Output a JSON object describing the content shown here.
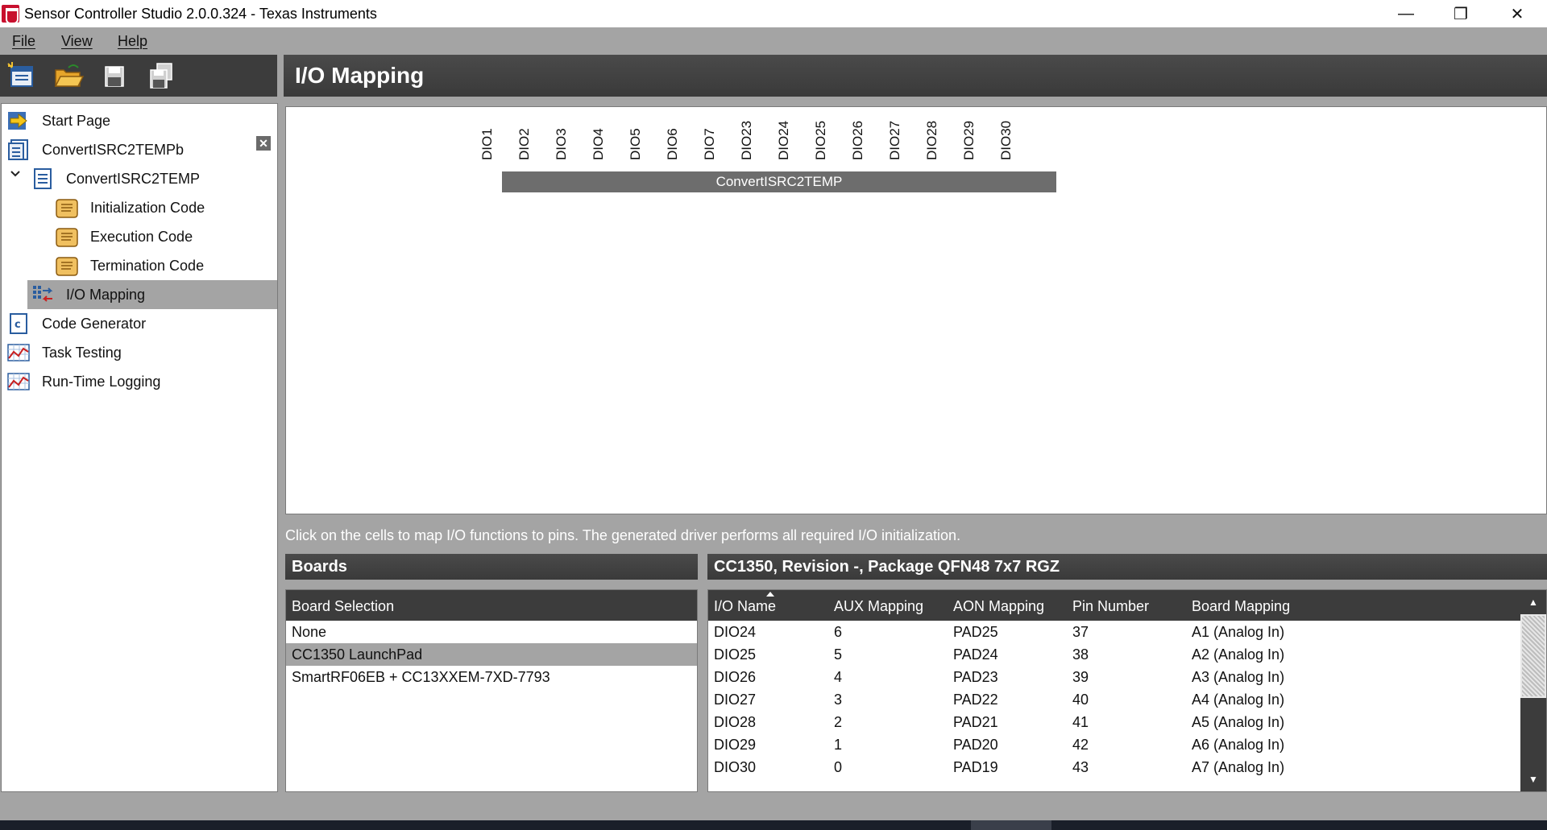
{
  "window": {
    "title": "Sensor Controller Studio 2.0.0.324 - Texas Instruments",
    "minimize": "—",
    "restore": "❐",
    "close": "✕"
  },
  "menu": {
    "file": "File",
    "view": "View",
    "help": "Help"
  },
  "toolbar": {
    "icons": [
      "new-project-icon",
      "open-folder-icon",
      "save-icon",
      "save-all-icon"
    ]
  },
  "header": {
    "title": "I/O Mapping"
  },
  "sidebar": {
    "items": [
      {
        "label": "Start Page",
        "icon": "arrow-right-icon"
      },
      {
        "label": "ConvertISRC2TEMPb",
        "icon": "project-icon"
      },
      {
        "label": "ConvertISRC2TEMP",
        "icon": "task-icon"
      },
      {
        "label": "Initialization Code",
        "icon": "script-icon"
      },
      {
        "label": "Execution Code",
        "icon": "script-icon"
      },
      {
        "label": "Termination Code",
        "icon": "script-icon"
      },
      {
        "label": "I/O Mapping",
        "icon": "io-mapping-icon"
      },
      {
        "label": "Code Generator",
        "icon": "code-generator-icon"
      },
      {
        "label": "Task Testing",
        "icon": "chart-icon"
      },
      {
        "label": "Run-Time Logging",
        "icon": "chart-icon"
      }
    ],
    "close_label": "✕"
  },
  "mapping": {
    "pins": [
      "DIO1",
      "DIO2",
      "DIO3",
      "DIO4",
      "DIO5",
      "DIO6",
      "DIO7",
      "DIO23",
      "DIO24",
      "DIO25",
      "DIO26",
      "DIO27",
      "DIO28",
      "DIO29",
      "DIO30"
    ],
    "task_name": "ConvertISRC2TEMP",
    "instruction": "Click on the cells to map I/O functions to pins. The generated driver performs all required I/O initialization."
  },
  "boards": {
    "header": "Boards",
    "column": "Board Selection",
    "rows": [
      "None",
      "CC1350 LaunchPad",
      "SmartRF06EB + CC13XXEM-7XD-7793"
    ],
    "selected_index": 1
  },
  "chip": {
    "header": "CC1350, Revision -, Package QFN48 7x7 RGZ",
    "columns": [
      "I/O Name",
      "AUX Mapping",
      "AON Mapping",
      "Pin Number",
      "Board Mapping"
    ],
    "rows": [
      [
        "DIO24",
        "6",
        "PAD25",
        "37",
        "A1 (Analog In)"
      ],
      [
        "DIO25",
        "5",
        "PAD24",
        "38",
        "A2 (Analog In)"
      ],
      [
        "DIO26",
        "4",
        "PAD23",
        "39",
        "A3 (Analog In)"
      ],
      [
        "DIO27",
        "3",
        "PAD22",
        "40",
        "A4 (Analog In)"
      ],
      [
        "DIO28",
        "2",
        "PAD21",
        "41",
        "A5 (Analog In)"
      ],
      [
        "DIO29",
        "1",
        "PAD20",
        "42",
        "A6 (Analog In)"
      ],
      [
        "DIO30",
        "0",
        "PAD19",
        "43",
        "A7 (Analog In)"
      ]
    ],
    "scroll_up": "▲",
    "scroll_down": "▼"
  }
}
